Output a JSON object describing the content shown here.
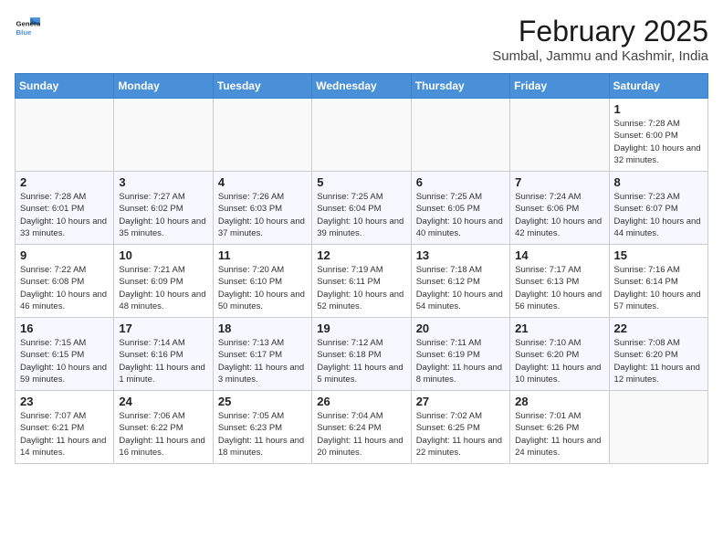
{
  "header": {
    "logo_line1": "General",
    "logo_line2": "Blue",
    "month_title": "February 2025",
    "location": "Sumbal, Jammu and Kashmir, India"
  },
  "weekdays": [
    "Sunday",
    "Monday",
    "Tuesday",
    "Wednesday",
    "Thursday",
    "Friday",
    "Saturday"
  ],
  "weeks": [
    [
      {
        "day": "",
        "info": ""
      },
      {
        "day": "",
        "info": ""
      },
      {
        "day": "",
        "info": ""
      },
      {
        "day": "",
        "info": ""
      },
      {
        "day": "",
        "info": ""
      },
      {
        "day": "",
        "info": ""
      },
      {
        "day": "1",
        "info": "Sunrise: 7:28 AM\nSunset: 6:00 PM\nDaylight: 10 hours and 32 minutes."
      }
    ],
    [
      {
        "day": "2",
        "info": "Sunrise: 7:28 AM\nSunset: 6:01 PM\nDaylight: 10 hours and 33 minutes."
      },
      {
        "day": "3",
        "info": "Sunrise: 7:27 AM\nSunset: 6:02 PM\nDaylight: 10 hours and 35 minutes."
      },
      {
        "day": "4",
        "info": "Sunrise: 7:26 AM\nSunset: 6:03 PM\nDaylight: 10 hours and 37 minutes."
      },
      {
        "day": "5",
        "info": "Sunrise: 7:25 AM\nSunset: 6:04 PM\nDaylight: 10 hours and 39 minutes."
      },
      {
        "day": "6",
        "info": "Sunrise: 7:25 AM\nSunset: 6:05 PM\nDaylight: 10 hours and 40 minutes."
      },
      {
        "day": "7",
        "info": "Sunrise: 7:24 AM\nSunset: 6:06 PM\nDaylight: 10 hours and 42 minutes."
      },
      {
        "day": "8",
        "info": "Sunrise: 7:23 AM\nSunset: 6:07 PM\nDaylight: 10 hours and 44 minutes."
      }
    ],
    [
      {
        "day": "9",
        "info": "Sunrise: 7:22 AM\nSunset: 6:08 PM\nDaylight: 10 hours and 46 minutes."
      },
      {
        "day": "10",
        "info": "Sunrise: 7:21 AM\nSunset: 6:09 PM\nDaylight: 10 hours and 48 minutes."
      },
      {
        "day": "11",
        "info": "Sunrise: 7:20 AM\nSunset: 6:10 PM\nDaylight: 10 hours and 50 minutes."
      },
      {
        "day": "12",
        "info": "Sunrise: 7:19 AM\nSunset: 6:11 PM\nDaylight: 10 hours and 52 minutes."
      },
      {
        "day": "13",
        "info": "Sunrise: 7:18 AM\nSunset: 6:12 PM\nDaylight: 10 hours and 54 minutes."
      },
      {
        "day": "14",
        "info": "Sunrise: 7:17 AM\nSunset: 6:13 PM\nDaylight: 10 hours and 56 minutes."
      },
      {
        "day": "15",
        "info": "Sunrise: 7:16 AM\nSunset: 6:14 PM\nDaylight: 10 hours and 57 minutes."
      }
    ],
    [
      {
        "day": "16",
        "info": "Sunrise: 7:15 AM\nSunset: 6:15 PM\nDaylight: 10 hours and 59 minutes."
      },
      {
        "day": "17",
        "info": "Sunrise: 7:14 AM\nSunset: 6:16 PM\nDaylight: 11 hours and 1 minute."
      },
      {
        "day": "18",
        "info": "Sunrise: 7:13 AM\nSunset: 6:17 PM\nDaylight: 11 hours and 3 minutes."
      },
      {
        "day": "19",
        "info": "Sunrise: 7:12 AM\nSunset: 6:18 PM\nDaylight: 11 hours and 5 minutes."
      },
      {
        "day": "20",
        "info": "Sunrise: 7:11 AM\nSunset: 6:19 PM\nDaylight: 11 hours and 8 minutes."
      },
      {
        "day": "21",
        "info": "Sunrise: 7:10 AM\nSunset: 6:20 PM\nDaylight: 11 hours and 10 minutes."
      },
      {
        "day": "22",
        "info": "Sunrise: 7:08 AM\nSunset: 6:20 PM\nDaylight: 11 hours and 12 minutes."
      }
    ],
    [
      {
        "day": "23",
        "info": "Sunrise: 7:07 AM\nSunset: 6:21 PM\nDaylight: 11 hours and 14 minutes."
      },
      {
        "day": "24",
        "info": "Sunrise: 7:06 AM\nSunset: 6:22 PM\nDaylight: 11 hours and 16 minutes."
      },
      {
        "day": "25",
        "info": "Sunrise: 7:05 AM\nSunset: 6:23 PM\nDaylight: 11 hours and 18 minutes."
      },
      {
        "day": "26",
        "info": "Sunrise: 7:04 AM\nSunset: 6:24 PM\nDaylight: 11 hours and 20 minutes."
      },
      {
        "day": "27",
        "info": "Sunrise: 7:02 AM\nSunset: 6:25 PM\nDaylight: 11 hours and 22 minutes."
      },
      {
        "day": "28",
        "info": "Sunrise: 7:01 AM\nSunset: 6:26 PM\nDaylight: 11 hours and 24 minutes."
      },
      {
        "day": "",
        "info": ""
      }
    ]
  ]
}
